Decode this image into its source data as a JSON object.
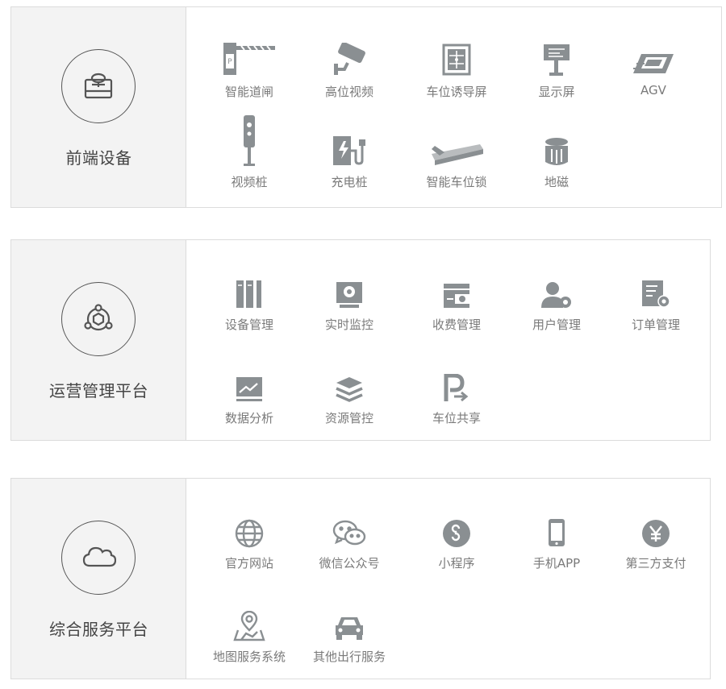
{
  "colors": {
    "icon": "#8a8f92",
    "border": "#dcdcdc",
    "panel_left_bg": "#f3f3f3",
    "title": "#444444",
    "label": "#7a7a7a"
  },
  "sections": [
    {
      "title": "前端设备",
      "icon": "device-tray-icon",
      "items": [
        {
          "label": "智能道闸",
          "icon": "barrier-gate-icon"
        },
        {
          "label": "高位视频",
          "icon": "surveillance-camera-icon"
        },
        {
          "label": "车位诱导屏",
          "icon": "guidance-screen-icon"
        },
        {
          "label": "显示屏",
          "icon": "display-sign-icon"
        },
        {
          "label": "AGV",
          "icon": "agv-icon"
        },
        {
          "label": "视频桩",
          "icon": "video-pile-icon"
        },
        {
          "label": "充电桩",
          "icon": "charging-pile-icon"
        },
        {
          "label": "智能车位锁",
          "icon": "parking-lock-icon"
        },
        {
          "label": "地磁",
          "icon": "geomagnetic-sensor-icon"
        }
      ]
    },
    {
      "title": "运营管理平台",
      "icon": "hub-network-icon",
      "items": [
        {
          "label": "设备管理",
          "icon": "device-management-icon"
        },
        {
          "label": "实时监控",
          "icon": "monitor-icon"
        },
        {
          "label": "收费管理",
          "icon": "wallet-icon"
        },
        {
          "label": "用户管理",
          "icon": "user-gear-icon"
        },
        {
          "label": "订单管理",
          "icon": "order-gear-icon"
        },
        {
          "label": "数据分析",
          "icon": "chart-analysis-icon"
        },
        {
          "label": "资源管控",
          "icon": "layers-icon"
        },
        {
          "label": "车位共享",
          "icon": "parking-share-icon"
        }
      ]
    },
    {
      "title": "综合服务平台",
      "icon": "cloud-icon",
      "items": [
        {
          "label": "官方网站",
          "icon": "globe-icon"
        },
        {
          "label": "微信公众号",
          "icon": "wechat-icon"
        },
        {
          "label": "小程序",
          "icon": "mini-program-icon"
        },
        {
          "label": "手机APP",
          "icon": "mobile-phone-icon"
        },
        {
          "label": "第三方支付",
          "icon": "yuan-payment-icon"
        },
        {
          "label": "地图服务系统",
          "icon": "map-pin-icon"
        },
        {
          "label": "其他出行服务",
          "icon": "car-icon"
        }
      ]
    }
  ]
}
